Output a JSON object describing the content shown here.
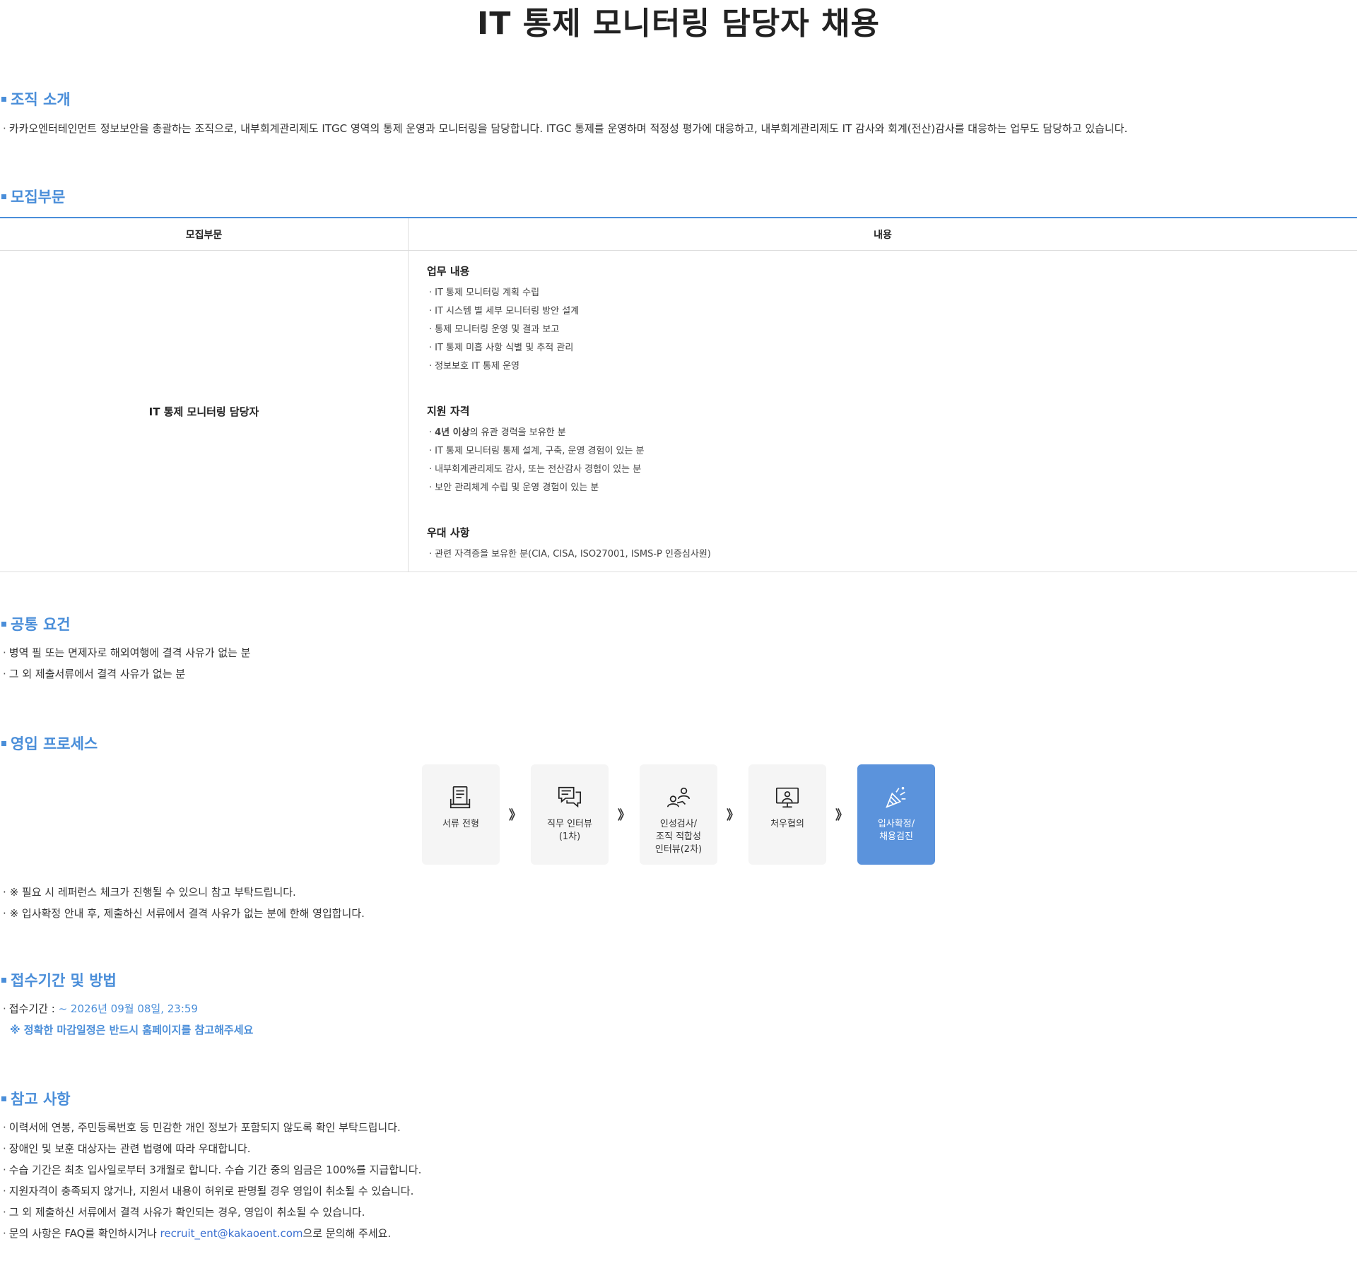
{
  "page_title": "IT 통제 모니터링 담당자 채용",
  "bullet": "·",
  "org": {
    "title": "조직 소개",
    "text": "카카오엔터테인먼트 정보보안을 총괄하는 조직으로, 내부회계관리제도 ITGC 영역의 통제 운영과 모니터링을 담당합니다. ITGC 통제를 운영하며 적정성 평가에 대응하고, 내부회계관리제도 IT 감사와 회계(전산)감사를 대응하는 업무도 담당하고 있습니다."
  },
  "recruit": {
    "title": "모집부문",
    "header_position": "모집부문",
    "header_content": "내용",
    "position": "IT 통제 모니터링 담당자",
    "duties_title": "업무 내용",
    "duties": [
      "IT 통제 모니터링 계획 수립",
      "IT 시스템 별 세부 모니터링 방안 설계",
      "통제 모니터링 운영 및 결과 보고",
      "IT 통제 미흡 사항 식별 및 추적 관리",
      "정보보호 IT 통제 운영"
    ],
    "quals_title": "지원 자격",
    "qual_first_bold": "4년 이상",
    "qual_first_rest": "의 유관 경력을 보유한 분",
    "quals": [
      "IT 통제 모니터링 통제 설계, 구축, 운영 경험이 있는 분",
      "내부회계관리제도 감사, 또는 전산감사 경험이 있는 분",
      "보안 관리체계 수립 및 운영 경험이 있는 분"
    ],
    "pref_title": "우대 사항",
    "prefs": [
      "관련 자격증을 보유한 분(CIA, CISA, ISO27001, ISMS-P 인증심사원)"
    ]
  },
  "common": {
    "title": "공통 요건",
    "items": [
      "병역 필 또는 면제자로 해외여행에 결격 사유가 없는 분",
      "그 외 제출서류에서 결격 사유가 없는 분"
    ]
  },
  "process": {
    "title": "영입 프로세스",
    "arrow": "》",
    "steps": [
      {
        "label": "서류 전형",
        "icon": "document-icon"
      },
      {
        "label": "직무 인터뷰\n(1차)",
        "icon": "chat-icon"
      },
      {
        "label": "인성검사/\n조직 적합성\n인터뷰(2차)",
        "icon": "people-icon"
      },
      {
        "label": "처우협의",
        "icon": "monitor-person-icon"
      },
      {
        "label": "입사확정/\n채용검진",
        "icon": "party-popper-icon"
      }
    ],
    "notes": [
      "※ 필요 시 레퍼런스 체크가 진행될 수 있으니 참고 부탁드립니다.",
      "※ 입사확정 안내 후, 제출하신 서류에서 결격 사유가 없는 분에 한해 영입합니다."
    ],
    "active_color": "#5b93dc"
  },
  "apply": {
    "title": "접수기간 및 방법",
    "period_label": "접수기간 :",
    "period_value": "~ 2026년 09월 08일, 23:59",
    "note": "※ 정확한 마감일정은 반드시 홈페이지를 참고해주세요"
  },
  "reference": {
    "title": "참고 사항",
    "items": [
      "이력서에 연봉, 주민등록번호 등 민감한 개인 정보가 포함되지 않도록 확인 부탁드립니다.",
      "장애인 및 보훈 대상자는 관련 법령에 따라 우대합니다.",
      "수습 기간은 최초 입사일로부터 3개월로 합니다. 수습 기간 중의 임금은 100%를 지급합니다.",
      "지원자격이 충족되지 않거나, 지원서 내용이 허위로 판명될 경우 영입이 취소될 수 있습니다.",
      "그 외 제출하신 서류에서 결격 사유가 확인되는 경우, 영입이 취소될 수 있습니다."
    ],
    "last_prefix": "문의 사항은 FAQ를 확인하시거나 ",
    "last_email": "recruit_ent@kakaoent.com",
    "last_suffix": "으로 문의해 주세요."
  },
  "colors": {
    "accent": "#4a8ed9",
    "link": "#3a6fd0"
  }
}
